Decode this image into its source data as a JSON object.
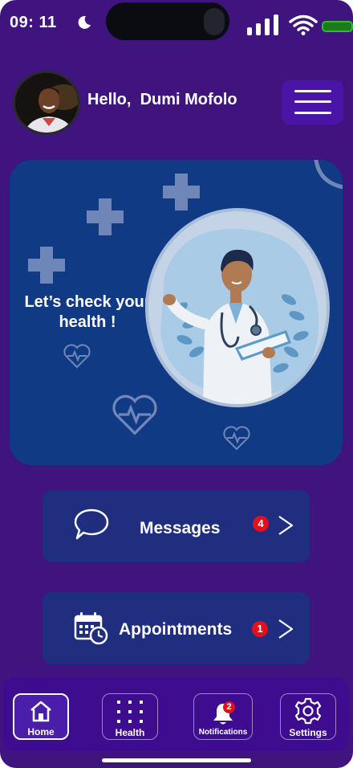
{
  "status_bar": {
    "time": "09: 11",
    "icons": [
      "moon-icon",
      "signal-icon",
      "wifi-icon",
      "battery-icon"
    ]
  },
  "header": {
    "greeting": "Hello,  Dumi Mofolo",
    "menu_icon": "hamburger-icon"
  },
  "hero": {
    "text": "Let’s check your health !",
    "illustration": "doctor-illustration"
  },
  "cards": {
    "messages": {
      "label": "Messages",
      "badge": "4",
      "icon": "chat-bubble-icon"
    },
    "appointments": {
      "label": "Appointments",
      "badge": "1",
      "icon": "calendar-clock-icon"
    }
  },
  "nav": {
    "home": {
      "label": "Home",
      "icon": "home-icon",
      "active": true
    },
    "health": {
      "label": "Health",
      "icon": "grid-icon"
    },
    "notifications": {
      "label": "Notifications",
      "icon": "bell-icon",
      "badge": "2"
    },
    "settings": {
      "label": "Settings",
      "icon": "gear-icon"
    }
  },
  "colors": {
    "background": "#3f147f",
    "hero": "#113a85",
    "card": "#1f2e7e",
    "nav": "#3d0c8f",
    "badge": "#e01020",
    "menu": "#4a14a6"
  }
}
